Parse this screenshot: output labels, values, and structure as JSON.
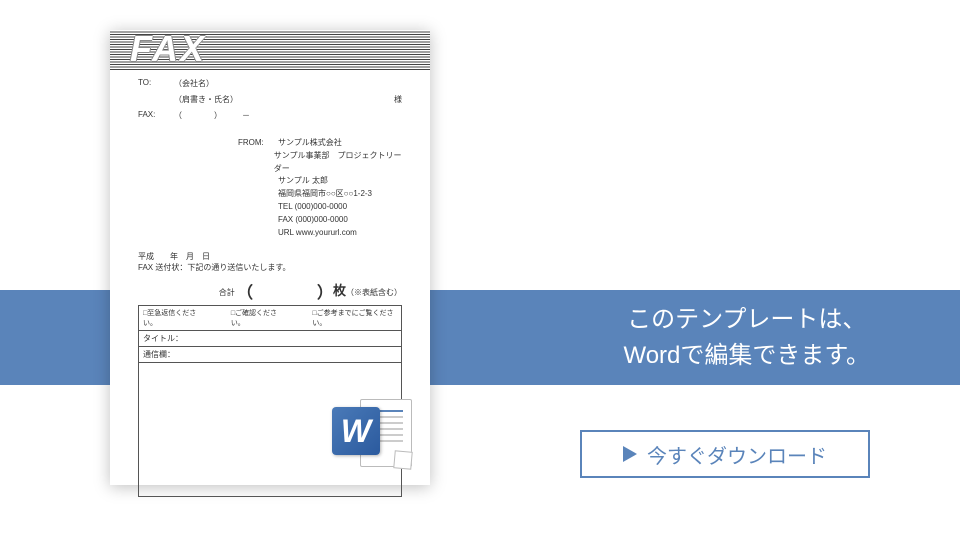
{
  "banner": {
    "line1": "このテンプレートは、",
    "line2": "Wordで編集できます。"
  },
  "download": {
    "label": "今すぐダウンロード"
  },
  "doc": {
    "fax": "FAX",
    "to": {
      "label": "TO:",
      "company": "（会社名）",
      "dept": "（肩書き・氏名）",
      "suffix": "様",
      "fax_label": "FAX:",
      "fax_value": "（　　　　）　　　－"
    },
    "from": {
      "label": "FROM:",
      "company": "サンプル株式会社",
      "dept": "サンプル事業部　プロジェクトリーダー",
      "name": "サンプル 太郎",
      "address": "福岡県福岡市○○区○○1-2-3",
      "tel": "TEL (000)000-0000",
      "fax": "FAX (000)000-0000",
      "url": "URL www.yoururl.com"
    },
    "date": "平成　　年　月　日",
    "cover": "FAX 送付状：下記の通り送信いたします。",
    "total": {
      "label": "合計",
      "note": "（※表紙含む）",
      "mai": "枚"
    },
    "checks": {
      "c1": "□至急返信ください。",
      "c2": "□ご確認ください。",
      "c3": "□ご参考までにご覧ください。"
    },
    "title_label": "タイトル：",
    "msg_label": "通信欄："
  }
}
